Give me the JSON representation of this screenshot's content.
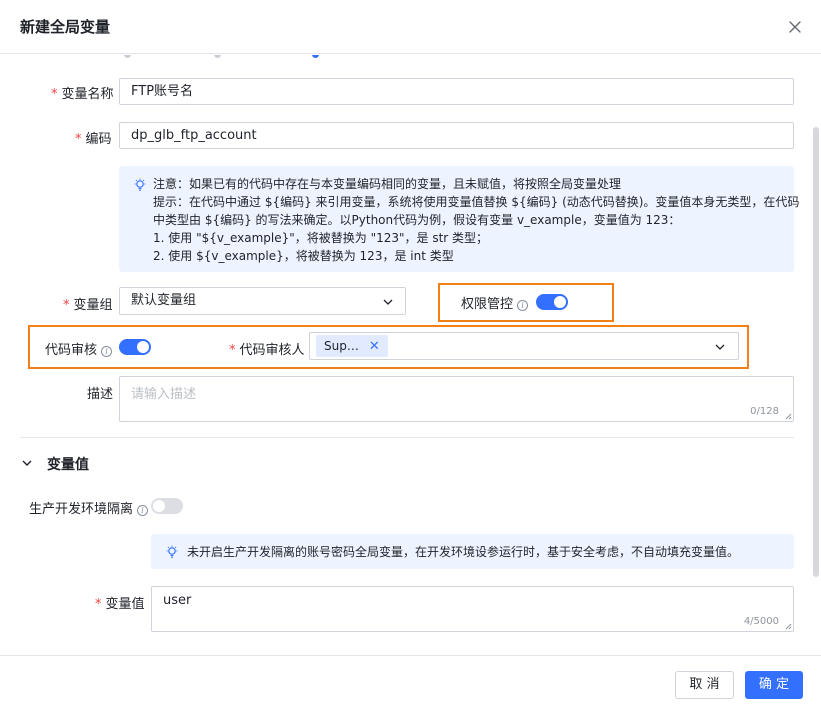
{
  "dialog": {
    "title": "新建全局变量"
  },
  "form": {
    "name": {
      "label": "变量名称",
      "value": "FTP账号名"
    },
    "code": {
      "label": "编码",
      "value": "dp_glb_ftp_account"
    },
    "notice": {
      "lines": [
        "注意：如果已有的代码中存在与本变量编码相同的变量，且未赋值，将按照全局变量处理",
        "提示：在代码中通过 ${编码} 来引用变量，系统将使用变量值替换 ${编码} (动态代码替换)。变量值本身无类型，在代码",
        "中类型由 ${编码} 的写法来确定。以Python代码为例，假设有变量 v_example，变量值为 123：",
        "1. 使用 \"${v_example}\"，将被替换为 \"123\"，是 str 类型；",
        "2. 使用 ${v_example}，将被替换为 123，是 int 类型"
      ]
    },
    "group": {
      "label": "变量组",
      "value": "默认变量组"
    },
    "permission": {
      "label": "权限管控",
      "enabled": true
    },
    "code_review": {
      "label": "代码审核",
      "enabled": true
    },
    "reviewer": {
      "label": "代码审核人",
      "tag": "Sup…"
    },
    "description": {
      "label": "描述",
      "placeholder": "请输入描述",
      "counter": "0/128"
    }
  },
  "values_section": {
    "title": "变量值",
    "isolation": {
      "label": "生产开发环境隔离",
      "enabled": false
    },
    "notice": "未开启生产开发隔离的账号密码全局变量，在开发环境设参运行时，基于安全考虑，不自动填充变量值。",
    "value": {
      "label": "变量值",
      "value": "user",
      "counter": "4/5000"
    }
  },
  "footer": {
    "cancel": "取 消",
    "ok": "确 定"
  },
  "colors": {
    "primary": "#3370ff",
    "required": "#f53f3f",
    "highlight": "#f08017",
    "info_bg": "#eef4ff"
  }
}
